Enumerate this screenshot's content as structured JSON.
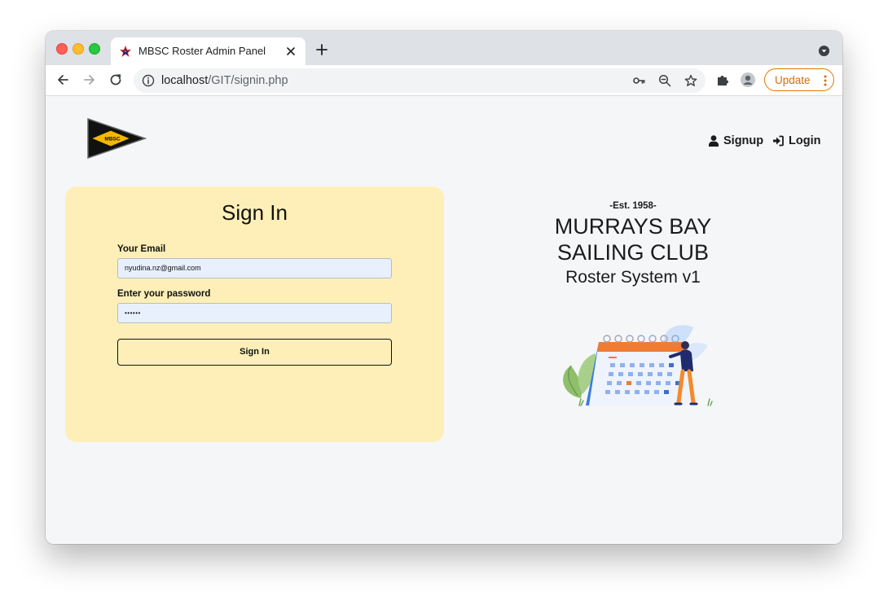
{
  "browser": {
    "tab_title": "MBSC Roster Admin Panel",
    "url_host": "localhost",
    "url_path": "/GIT/signin.php",
    "update_label": "Update",
    "accent_update": "#e37400"
  },
  "header": {
    "logo_text": "MBSC",
    "nav": [
      {
        "label": "Signup",
        "icon": "user-icon"
      },
      {
        "label": "Login",
        "icon": "sign-in-icon"
      }
    ]
  },
  "signin_card": {
    "title": "Sign In",
    "email_label": "Your Email",
    "email_value": "nyudina.nz@gmail.com",
    "password_label": "Enter your password",
    "password_value": "••••••",
    "button_label": "Sign In",
    "background": "#feefb8"
  },
  "club": {
    "established": "-Est. 1958-",
    "name": "MURRAYS BAY SAILING CLUB",
    "system": "Roster System v1"
  }
}
